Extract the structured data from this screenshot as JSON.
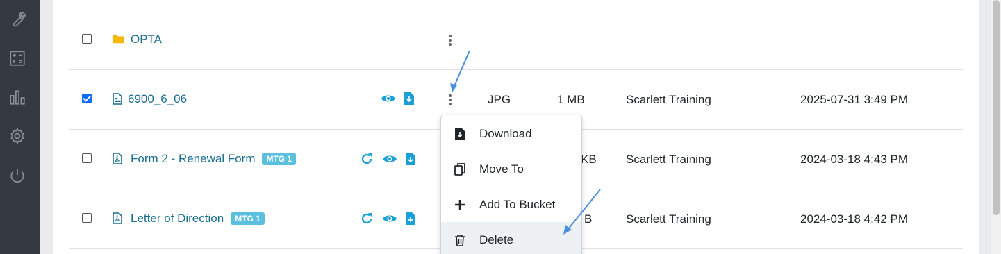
{
  "sidebar": {
    "icons": [
      "wrench-icon",
      "calculator-icon",
      "chart-icon",
      "gear-icon",
      "power-icon"
    ]
  },
  "rows": [
    {
      "name": "OPTA",
      "type": "folder",
      "checked": false
    },
    {
      "name": "6900_6_06",
      "type": "image",
      "checked": true,
      "filetype": "JPG",
      "size": "1 MB",
      "owner": "Scarlett Training",
      "date": "2025-07-31 3:49 PM"
    },
    {
      "name": "Form 2 - Renewal Form",
      "type": "pdf",
      "checked": false,
      "badge": "MTG 1",
      "size_partial": "KB",
      "owner": "Scarlett Training",
      "date": "2024-03-18 4:43 PM"
    },
    {
      "name": "Letter of Direction",
      "type": "pdf",
      "checked": false,
      "badge": "MTG 1",
      "size_partial": "B",
      "owner": "Scarlett Training",
      "date": "2024-03-18 4:42 PM"
    }
  ],
  "context_menu": {
    "items": [
      {
        "label": "Download",
        "icon": "download-icon"
      },
      {
        "label": "Move To",
        "icon": "copy-icon"
      },
      {
        "label": "Add To Bucket",
        "icon": "plus-icon"
      },
      {
        "label": "Delete",
        "icon": "trash-icon",
        "highlighted": true
      }
    ]
  },
  "colors": {
    "accent": "#1a9fd6",
    "link": "#1a6f8f",
    "badge": "#5bc0de",
    "sidebar": "#343a40"
  }
}
